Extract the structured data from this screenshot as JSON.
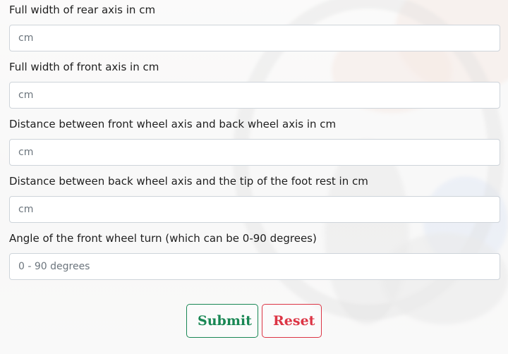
{
  "form": {
    "fields": [
      {
        "label": "Full width of rear axis in cm",
        "value": "",
        "placeholder": "cm"
      },
      {
        "label": "Full width of front axis in cm",
        "value": "",
        "placeholder": "cm"
      },
      {
        "label": "Distance between front wheel axis and back wheel axis in cm",
        "value": "",
        "placeholder": "cm"
      },
      {
        "label": "Distance between back wheel axis and the tip of the foot rest in cm",
        "value": "",
        "placeholder": "cm"
      },
      {
        "label": "Angle of the front wheel turn (which can be 0-90 degrees)",
        "value": "",
        "placeholder": "0 - 90 degrees"
      }
    ]
  },
  "actions": {
    "submit_label": "Submit",
    "reset_label": "Reset"
  },
  "colors": {
    "submit": "#198754",
    "reset": "#dc3545",
    "input_border": "#ced4da",
    "placeholder": "#6c757d"
  }
}
